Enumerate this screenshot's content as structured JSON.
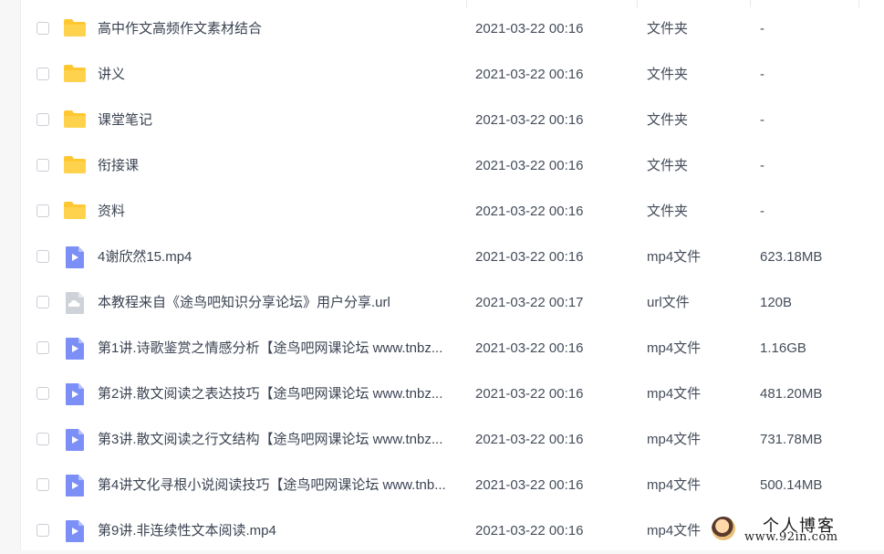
{
  "files": [
    {
      "name": "高中作文高频作文素材结合",
      "time": "2021-03-22 00:16",
      "type": "文件夹",
      "size": "-",
      "icon": "folder-icon"
    },
    {
      "name": "讲义",
      "time": "2021-03-22 00:16",
      "type": "文件夹",
      "size": "-",
      "icon": "folder-icon"
    },
    {
      "name": "课堂笔记",
      "time": "2021-03-22 00:16",
      "type": "文件夹",
      "size": "-",
      "icon": "folder-icon"
    },
    {
      "name": "衔接课",
      "time": "2021-03-22 00:16",
      "type": "文件夹",
      "size": "-",
      "icon": "folder-icon"
    },
    {
      "name": "资料",
      "time": "2021-03-22 00:16",
      "type": "文件夹",
      "size": "-",
      "icon": "folder-icon"
    },
    {
      "name": "4谢欣然15.mp4",
      "time": "2021-03-22 00:16",
      "type": "mp4文件",
      "size": "623.18MB",
      "icon": "video-file-icon"
    },
    {
      "name": "本教程来自《途鸟吧知识分享论坛》用户分享.url",
      "time": "2021-03-22 00:17",
      "type": "url文件",
      "size": "120B",
      "icon": "cloud-file-icon"
    },
    {
      "name": "第1讲.诗歌鉴赏之情感分析【途鸟吧网课论坛 www.tnbz...",
      "time": "2021-03-22 00:16",
      "type": "mp4文件",
      "size": "1.16GB",
      "icon": "video-file-icon"
    },
    {
      "name": "第2讲.散文阅读之表达技巧【途鸟吧网课论坛 www.tnbz...",
      "time": "2021-03-22 00:16",
      "type": "mp4文件",
      "size": "481.20MB",
      "icon": "video-file-icon"
    },
    {
      "name": "第3讲.散文阅读之行文结构【途鸟吧网课论坛 www.tnbz...",
      "time": "2021-03-22 00:16",
      "type": "mp4文件",
      "size": "731.78MB",
      "icon": "video-file-icon"
    },
    {
      "name": "第4讲文化寻根小说阅读技巧【途鸟吧网课论坛 www.tnb...",
      "time": "2021-03-22 00:16",
      "type": "mp4文件",
      "size": "500.14MB",
      "icon": "video-file-icon"
    },
    {
      "name": "第9讲.非连续性文本阅读.mp4",
      "time": "2021-03-22 00:16",
      "type": "mp4文件",
      "size": "",
      "icon": "video-file-icon"
    }
  ],
  "watermark": {
    "title": "个人博客",
    "url": "www.92in.com"
  },
  "colors": {
    "folder": "#ffc832",
    "video": "#7c8ff7",
    "cloud": "#cfd3d9"
  }
}
